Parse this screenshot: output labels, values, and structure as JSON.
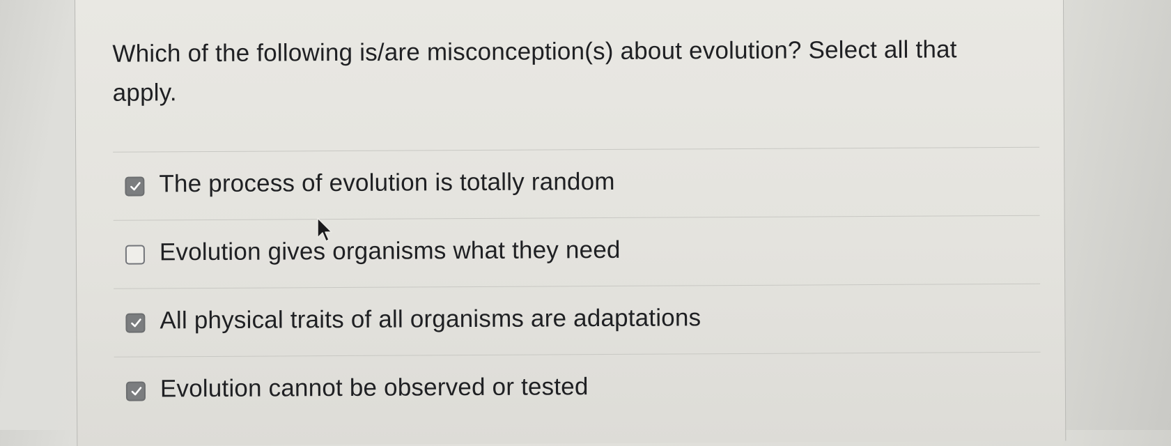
{
  "question": {
    "text": "Which of the following is/are misconception(s) about evolution? Select all that apply."
  },
  "options": [
    {
      "label": "The process of evolution is totally random",
      "checked": true
    },
    {
      "label": "Evolution gives organisms what they need",
      "checked": false
    },
    {
      "label": "All physical traits of all organisms are adaptations",
      "checked": true
    },
    {
      "label": "Evolution cannot be observed or tested",
      "checked": true
    }
  ],
  "colors": {
    "checkbox_checked": "#7b7d7f",
    "checkmark": "#ffffff",
    "divider": "#c8c8c3"
  },
  "icons": {
    "checkmark": "check-icon",
    "cursor": "mouse-pointer-icon"
  }
}
